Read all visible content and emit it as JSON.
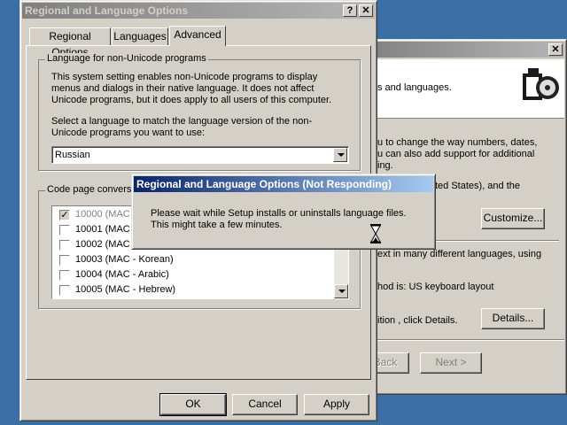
{
  "front_dialog": {
    "title": "Regional and Language Options",
    "help_btn": "?",
    "close_btn": "✕",
    "tabs": [
      "Regional Options",
      "Languages",
      "Advanced"
    ],
    "group1": {
      "legend": "Language for non-Unicode programs",
      "desc1": "This system setting enables non-Unicode programs to display menus and dialogs in their native language. It does not affect Unicode programs, but it does apply to all users of this computer.",
      "desc2": "Select a language to match the language version of the non-Unicode programs you want to use:",
      "selected_language": "Russian"
    },
    "group2": {
      "legend": "Code page conversi",
      "items": [
        {
          "label": "10000 (MAC -",
          "checked": true,
          "disabled": true
        },
        {
          "label": "10001 (MAC -",
          "checked": false
        },
        {
          "label": "10002 (MAC -",
          "checked": false
        },
        {
          "label": "10003 (MAC - Korean)",
          "checked": false
        },
        {
          "label": "10004 (MAC - Arabic)",
          "checked": false
        },
        {
          "label": "10005 (MAC - Hebrew)",
          "checked": false
        }
      ],
      "check_mark": "✓"
    },
    "buttons": {
      "ok": "OK",
      "cancel": "Cancel",
      "apply": "Apply"
    }
  },
  "back_window": {
    "close_btn": "✕",
    "text1": "s and languages.",
    "text2": "u to change the way numbers, dates,",
    "text3": "u can also add support for additional",
    "text4": "ing.",
    "text5": "ted States), and the",
    "customize_btn": "Customize...",
    "text6": "ext in many different languages, using",
    "text7": "hod is: US keyboard layout",
    "text8": "ition , click Details.",
    "details_btn": "Details...",
    "back_btn": "Back",
    "next_btn": "Next >"
  },
  "not_responding": {
    "title": "Regional and Language Options (Not Responding)",
    "message": "Please wait while Setup installs or uninstalls language files. This might take a few minutes."
  },
  "colors": {
    "desktop": "#3a6ea5",
    "dialog_face": "#d4d0c8",
    "active_title": "#0a246a"
  }
}
